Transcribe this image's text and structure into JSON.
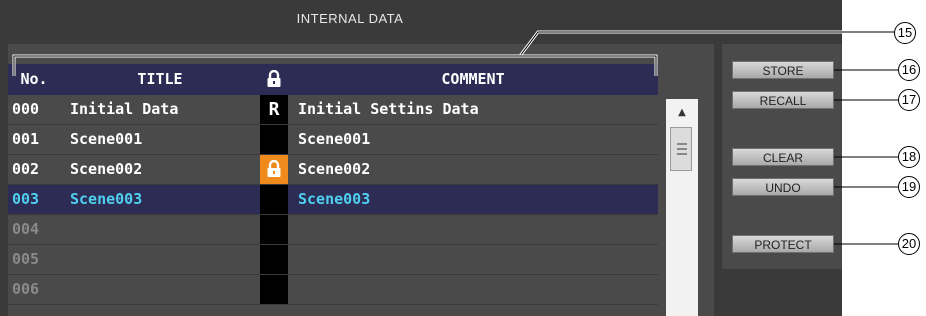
{
  "panel_title": "INTERNAL DATA",
  "table": {
    "headers": {
      "no": "No.",
      "title": "TITLE",
      "lock": "lock-icon",
      "comment": "COMMENT"
    },
    "rows": [
      {
        "no": "000",
        "title": "Initial Data",
        "lock": "R",
        "comment": "Initial Settins Data"
      },
      {
        "no": "001",
        "title": "Scene001",
        "lock": "",
        "comment": "Scene001"
      },
      {
        "no": "002",
        "title": "Scene002",
        "lock": "lock-icon",
        "comment": "Scene002"
      },
      {
        "no": "003",
        "title": "Scene003",
        "lock": "",
        "comment": "Scene003",
        "selected": true
      },
      {
        "no": "004",
        "title": "",
        "lock": "",
        "comment": ""
      },
      {
        "no": "005",
        "title": "",
        "lock": "",
        "comment": ""
      },
      {
        "no": "006",
        "title": "",
        "lock": "",
        "comment": ""
      }
    ]
  },
  "buttons": {
    "store": "STORE",
    "recall": "RECALL",
    "clear": "CLEAR",
    "undo": "UNDO",
    "protect": "PROTECT"
  },
  "callouts": {
    "c15": "15",
    "c16": "16",
    "c17": "17",
    "c18": "18",
    "c19": "19",
    "c20": "20"
  },
  "colors": {
    "panel": "#3a3a3a",
    "header": "#2c2c55",
    "selected_text": "#4fd0f0",
    "lock_orange": "#f08a1c"
  }
}
